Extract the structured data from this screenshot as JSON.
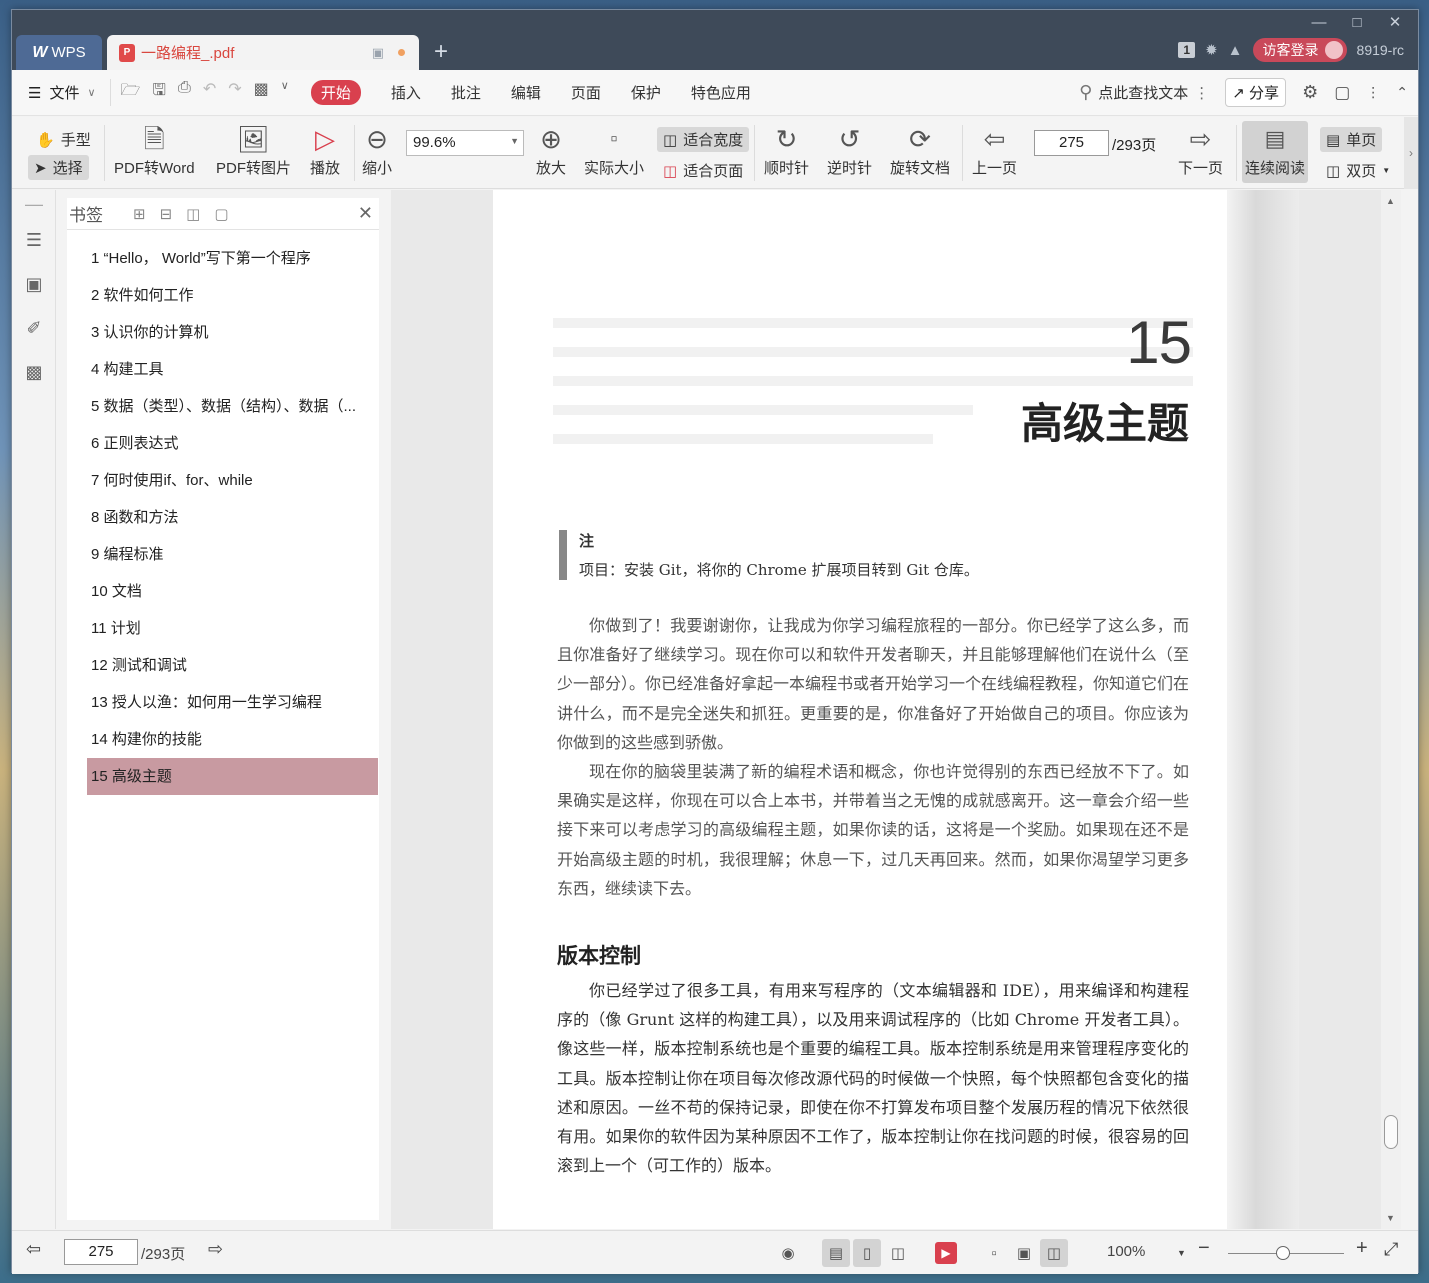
{
  "titlebar": {
    "app_tab": "WPS",
    "doc_tab": "一路编程_.pdf",
    "badge": "1",
    "visitor_login": "访客登录",
    "user_id": "8919-rc",
    "new_tab": "+"
  },
  "menubar": {
    "file": "文件",
    "items": [
      "开始",
      "插入",
      "批注",
      "编辑",
      "页面",
      "保护",
      "特色应用"
    ],
    "active": "开始",
    "search": "点此查找文本",
    "share": "分享"
  },
  "ribbon": {
    "hand": "手型",
    "select": "选择",
    "pdf_to_word": "PDF转Word",
    "pdf_to_image": "PDF转图片",
    "play": "播放",
    "zoom_out": "缩小",
    "zoom_value": "99.6%",
    "zoom_in": "放大",
    "actual_size": "实际大小",
    "fit_width": "适合宽度",
    "fit_page": "适合页面",
    "rotate_cw": "顺时针",
    "rotate_ccw": "逆时针",
    "rotate_doc": "旋转文档",
    "prev_page": "上一页",
    "page_current": "275",
    "page_total": "/293页",
    "next_page": "下一页",
    "continuous": "连续阅读",
    "single_page": "单页",
    "double_page": "双页"
  },
  "bookmarks": {
    "title": "书签",
    "items": [
      "1 “Hello， World”写下第一个程序",
      "2 软件如何工作",
      "3 认识你的计算机",
      "4 构建工具",
      "5 数据（类型）、数据（结构）、数据（...",
      "6 正则表达式",
      "7 何时使用if、for、while",
      "8 函数和方法",
      "9 编程标准",
      "10 文档",
      "11 计划",
      "12 测试和调试",
      "13 授人以渔：如何用一生学习编程",
      "14 构建你的技能",
      "15 高级主题"
    ],
    "selected_index": 14
  },
  "page": {
    "chapter_number": "15",
    "chapter_title": "高级主题",
    "note_heading": "注",
    "note_text": "项目：安装 Git，将你的 Chrome 扩展项目转到 Git 仓库。",
    "para1": "你做到了！我要谢谢你，让我成为你学习编程旅程的一部分。你已经学了这么多，而且你准备好了继续学习。现在你可以和软件开发者聊天，并且能够理解他们在说什么（至少一部分）。你已经准备好拿起一本编程书或者开始学习一个在线编程教程，你知道它们在讲什么，而不是完全迷失和抓狂。更重要的是，你准备好了开始做自己的项目。你应该为你做到的这些感到骄傲。",
    "para2": "现在你的脑袋里装满了新的编程术语和概念，你也许觉得别的东西已经放不下了。如果确实是这样，你现在可以合上本书，并带着当之无愧的成就感离开。这一章会介绍一些接下来可以考虑学习的高级编程主题，如果你读的话，这将是一个奖励。如果现在还不是开始高级主题的时机，我很理解；休息一下，过几天再回来。然而，如果你渴望学习更多东西，继续读下去。",
    "section_title": "版本控制",
    "para3": "你已经学过了很多工具，有用来写程序的（文本编辑器和 IDE），用来编译和构建程序的（像 Grunt 这样的构建工具），以及用来调试程序的（比如 Chrome 开发者工具）。像这些一样，版本控制系统也是个重要的编程工具。版本控制系统是用来管理程序变化的工具。版本控制让你在项目每次修改源代码的时候做一个快照，每个快照都包含变化的描述和原因。一丝不苟的保持记录，即使在你不打算发布项目整个发展历程的情况下依然很有用。如果你的软件因为某种原因不工作了，版本控制让你在找问题的时候，很容易的回滚到上一个（可工作的）版本。"
  },
  "statusbar": {
    "page_current": "275",
    "page_total": "/293页",
    "zoom": "100%"
  },
  "colors": {
    "accent": "#d9404e",
    "titlebar": "#3e4a59",
    "selected_bookmark": "#c89aa1"
  }
}
